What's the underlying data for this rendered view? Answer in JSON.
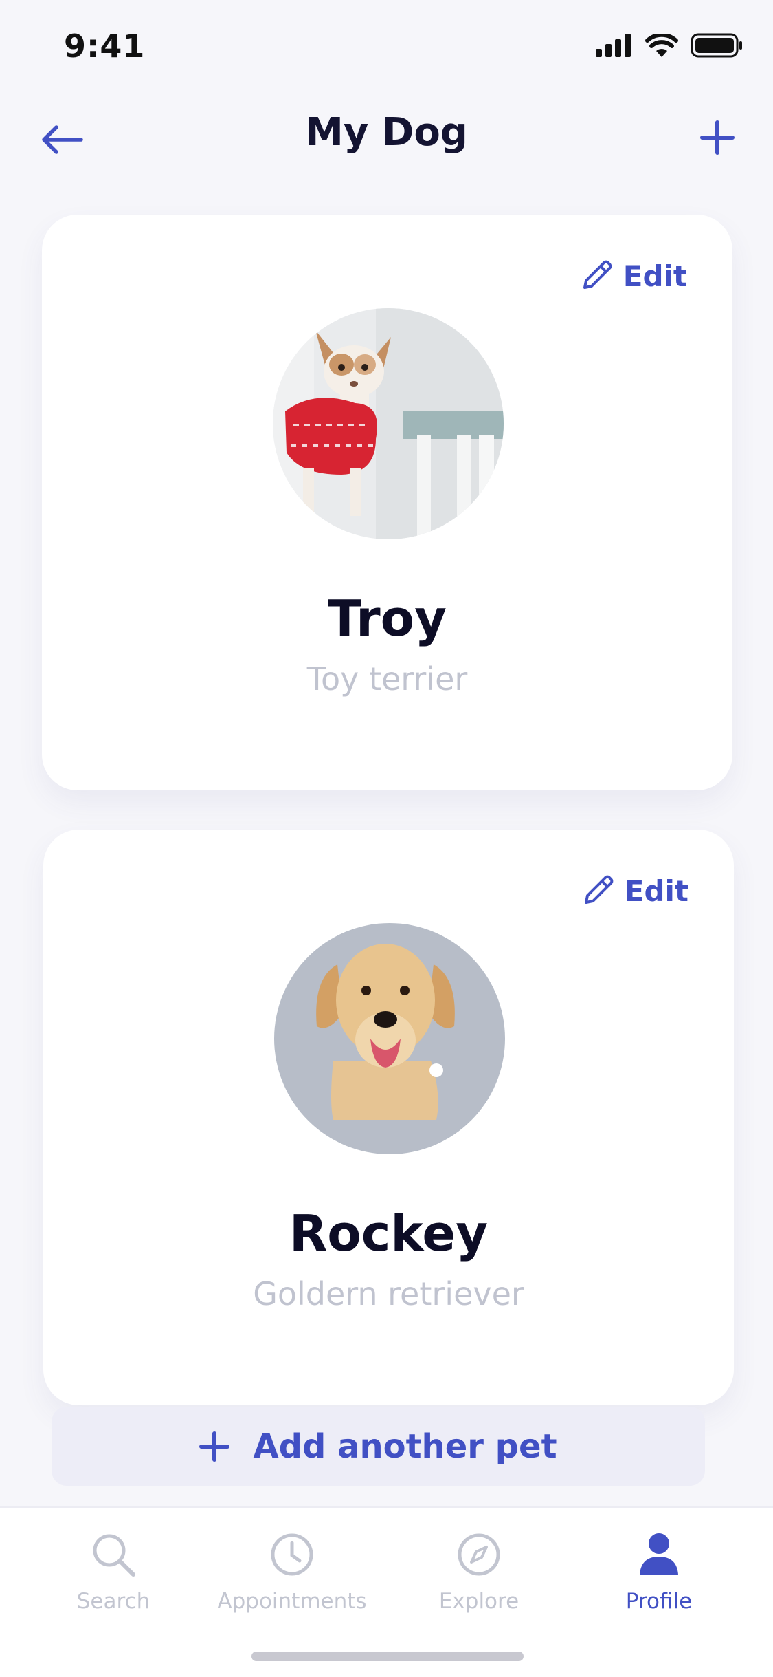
{
  "status_bar": {
    "time": "9:41",
    "icons": [
      "signal-icon",
      "wifi-icon",
      "battery-icon"
    ]
  },
  "nav": {
    "title": "My Dog",
    "back_icon": "arrow-left-icon",
    "add_icon": "plus-icon"
  },
  "colors": {
    "accent": "#4150C4",
    "background": "#F6F6FA",
    "card": "#FFFFFF",
    "muted": "#C0C3CF",
    "avatar_bg_2": "#B7BDC8"
  },
  "pets": [
    {
      "name": "Troy",
      "breed": "Toy terrier",
      "edit_label": "Edit",
      "photo": "chihuahua-in-red-sweater"
    },
    {
      "name": "Rockey",
      "breed": "Goldern retriever",
      "edit_label": "Edit",
      "photo": "golden-retriever"
    }
  ],
  "add_pet": {
    "label": "Add another pet"
  },
  "tabs": [
    {
      "label": "Search",
      "icon": "search-icon",
      "active": false
    },
    {
      "label": "Appointments",
      "icon": "clock-icon",
      "active": false
    },
    {
      "label": "Explore",
      "icon": "compass-icon",
      "active": false
    },
    {
      "label": "Profile",
      "icon": "user-icon",
      "active": true
    }
  ]
}
